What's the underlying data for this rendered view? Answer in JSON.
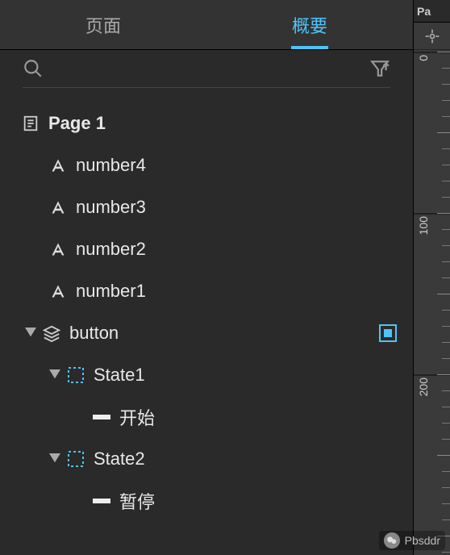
{
  "tabs": {
    "pages": "页面",
    "overview": "概要",
    "active": "overview"
  },
  "right_header": "Pa",
  "tree": {
    "root": "Page 1",
    "items": [
      {
        "type": "text",
        "label": "number4"
      },
      {
        "type": "text",
        "label": "number3"
      },
      {
        "type": "text",
        "label": "number2"
      },
      {
        "type": "text",
        "label": "number1"
      }
    ],
    "button_group": {
      "label": "button",
      "states": [
        {
          "label": "State1",
          "child": "开始"
        },
        {
          "label": "State2",
          "child": "暂停"
        }
      ]
    }
  },
  "ruler": {
    "marks": [
      "0",
      "100",
      "200"
    ]
  },
  "watermark": "Pbsddr"
}
